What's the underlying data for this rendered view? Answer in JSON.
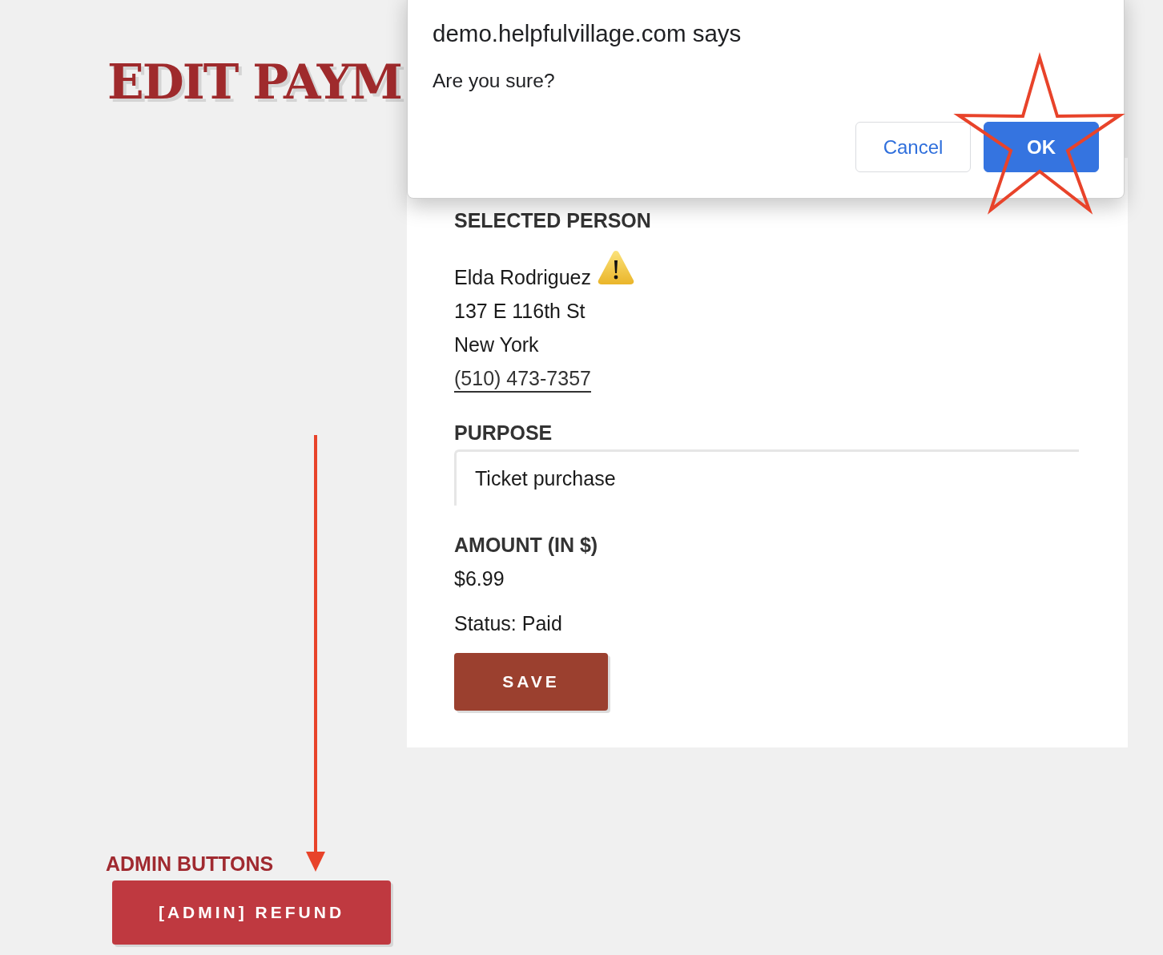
{
  "page": {
    "title": "EDIT PAYM"
  },
  "dialog": {
    "title": "demo.helpfulvillage.com says",
    "message": "Are you sure?",
    "buttons": [
      {
        "label": "Cancel",
        "kind": "secondary"
      },
      {
        "label": "OK",
        "kind": "primary"
      }
    ]
  },
  "form": {
    "selected_person": {
      "heading": "SELECTED PERSON",
      "name": "Elda Rodriguez",
      "warning": true,
      "address": "137 E 116th St",
      "city": "New York",
      "phone": "(510) 473-7357"
    },
    "purpose": {
      "label": "PURPOSE",
      "value": "Ticket purchase"
    },
    "amount": {
      "label": "AMOUNT (IN $)",
      "value": "$6.99"
    },
    "status": "Status: Paid",
    "save_button": "SAVE"
  },
  "admin": {
    "heading": "ADMIN BUTTONS",
    "buttons": [
      "[ADMIN] REFUND"
    ]
  }
}
